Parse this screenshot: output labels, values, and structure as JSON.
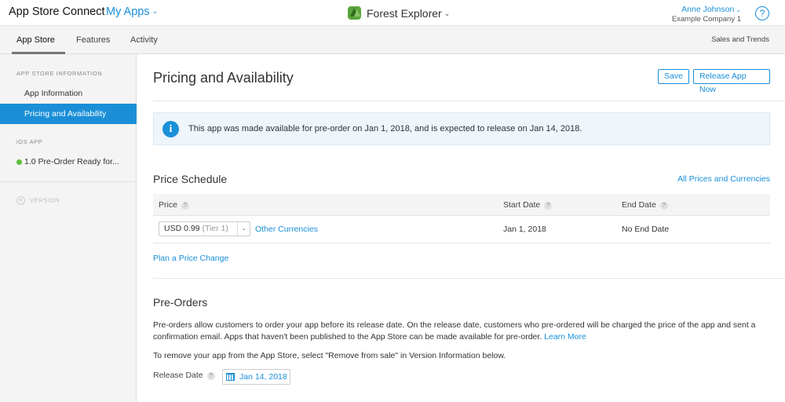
{
  "header": {
    "brand": "App Store Connect",
    "my_apps": "My Apps",
    "app_name": "Forest Explorer",
    "user_name": "Anne Johnson",
    "user_company": "Example Company 1",
    "help": "?"
  },
  "tabs": {
    "items": [
      "App Store",
      "Features",
      "Activity"
    ],
    "active": "App Store",
    "right_link": "Sales and Trends"
  },
  "sidebar": {
    "section1": "APP STORE INFORMATION",
    "items": [
      "App Information",
      "Pricing and Availability"
    ],
    "selected": "Pricing and Availability",
    "section2": "iOS APP",
    "ios_item": "1.0 Pre-Order Ready for...",
    "version_label": "VERSION",
    "version_plus": "+"
  },
  "main": {
    "title": "Pricing and Availability",
    "save": "Save",
    "release_now": "Release App Now",
    "info_icon": "i",
    "info_text": "This app was made available for pre-order on Jan 1, 2018, and is expected to release on Jan 14, 2018.",
    "price_schedule": {
      "title": "Price Schedule",
      "all_prices_link": "All Prices and Currencies",
      "columns": [
        "Price",
        "Start Date",
        "End Date"
      ],
      "help_mark": "?",
      "row": {
        "price_value": "USD 0.99",
        "price_tier": "(Tier 1)",
        "select_arrow": "⌄",
        "other_currencies": "Other Currencies",
        "start_date": "Jan 1, 2018",
        "end_date": "No End Date"
      },
      "plan_change": "Plan a Price Change"
    },
    "pre_orders": {
      "title": "Pre-Orders",
      "description": "Pre-orders allow customers to order your app before its release date. On the release date, customers who pre-ordered will be charged the price of the app and sent a confirmation email. Apps that haven't been published to the App Store can be made available for pre-order.",
      "learn_more": "Learn More",
      "remove_note": "To remove your app from the App Store, select \"Remove from sale\" in Version Information below.",
      "release_date_label": "Release Date",
      "release_date_value": "Jan 14, 2018"
    }
  },
  "colors": {
    "accent": "#1a8fd8",
    "status_green": "#5fbf3a"
  }
}
